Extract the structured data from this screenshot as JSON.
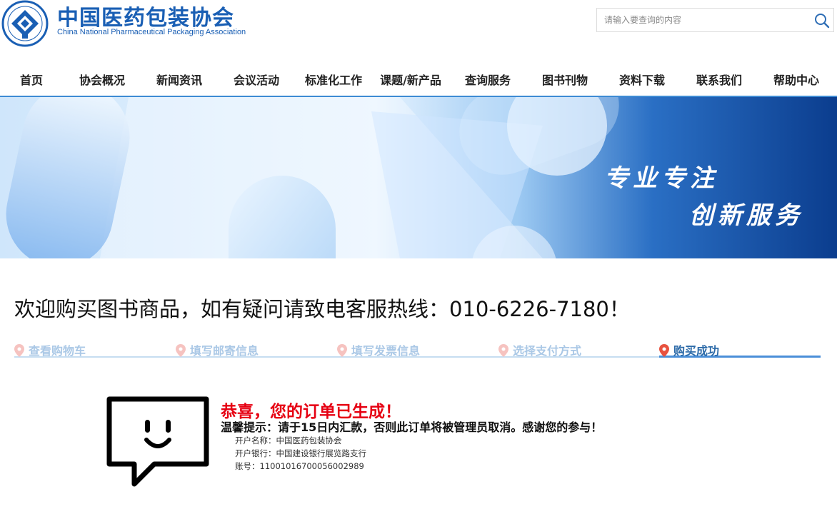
{
  "header": {
    "brand_cn": "中国医药包装协会",
    "brand_en": "China National Pharmaceutical Packaging Association",
    "search_placeholder": "请输入要查询的内容"
  },
  "nav": {
    "items": [
      "首页",
      "协会概况",
      "新闻资讯",
      "会议活动",
      "标准化工作",
      "课题/新产品",
      "查询服务",
      "图书刊物",
      "资料下载",
      "联系我们",
      "帮助中心"
    ]
  },
  "banner": {
    "line1": "专业专注",
    "line2": "创新服务"
  },
  "welcome": "欢迎购买图书商品，如有疑问请致电客服热线：010-6226-7180！",
  "steps": [
    "查看购物车",
    "填写邮寄信息",
    "填写发票信息",
    "选择支付方式",
    "购买成功"
  ],
  "result": {
    "title": "恭喜，您的订单已生成！",
    "tip": "温馨提示：请于15日内汇款，否则此订单将被管理员取消。感谢您的参与！",
    "account_name": "开户名称：中国医药包装协会",
    "bank": "开户银行：中国建设银行展览路支行",
    "account_no": "账号：11001016700056002989"
  },
  "colors": {
    "brand": "#1a5fb4",
    "accent": "#3d8bd4",
    "step_inactive": "#aac8e6",
    "step_active": "#2c6aa8",
    "alert_red": "#e60012"
  }
}
